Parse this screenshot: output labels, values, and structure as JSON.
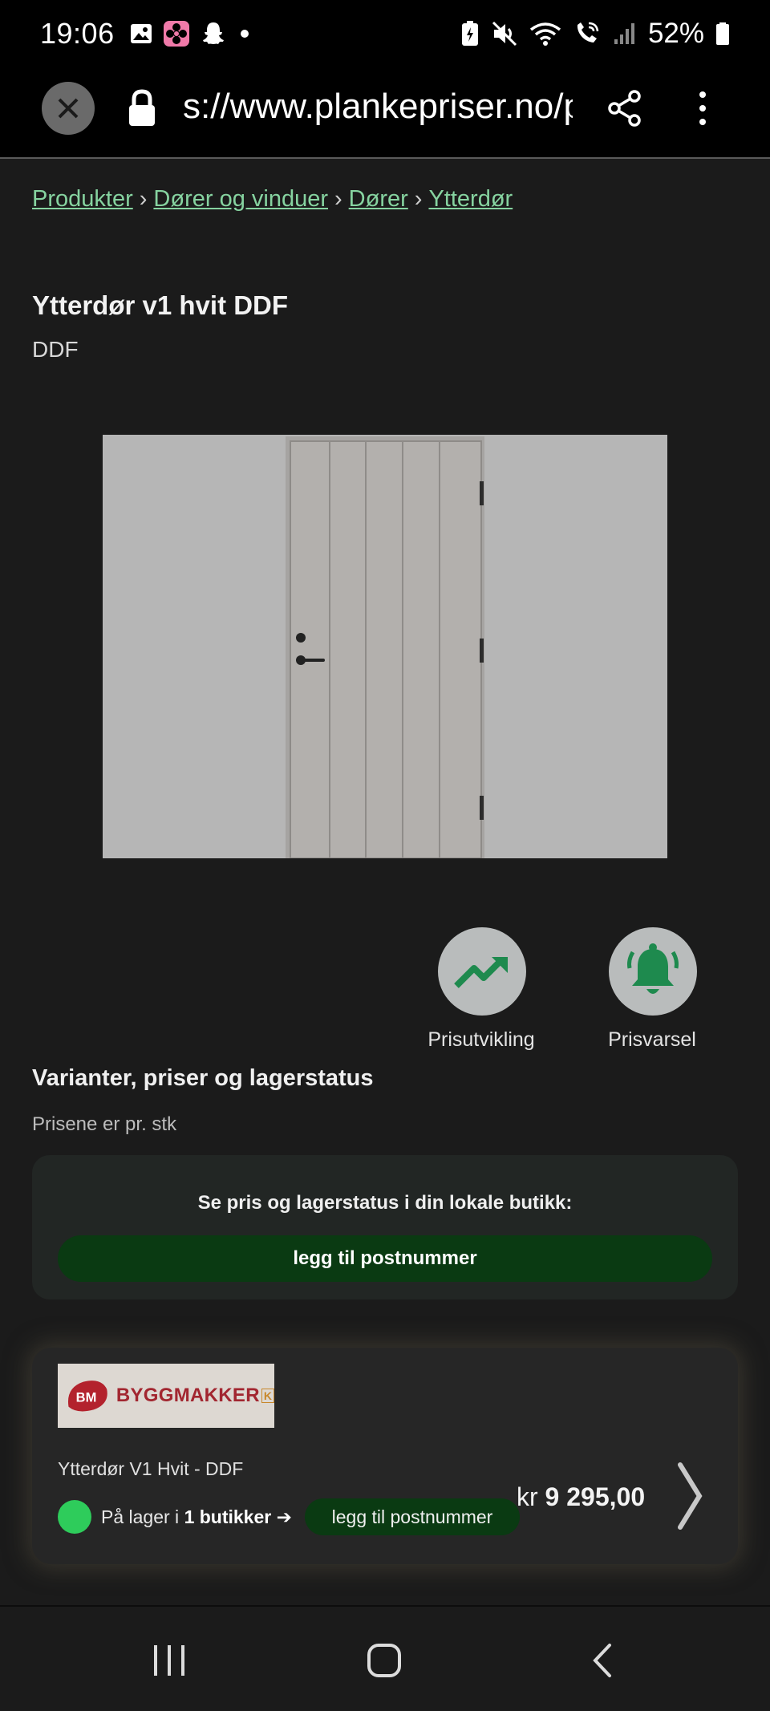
{
  "status_bar": {
    "time": "19:06",
    "battery_percent": "52%",
    "icons_left": [
      "gallery-icon",
      "flower-app-icon",
      "snapchat-icon",
      "dot-icon"
    ],
    "icons_right": [
      "battery-saver-icon",
      "mute-icon",
      "wifi-icon",
      "wifi-calling-icon",
      "signal-icon",
      "battery-icon"
    ]
  },
  "browser": {
    "url": "s://www.plankepriser.no/p"
  },
  "breadcrumb": {
    "items": [
      "Produkter",
      "Dører og vinduer",
      "Dører",
      "Ytterdør"
    ],
    "separator": "›"
  },
  "product": {
    "title": "Ytterdør v1 hvit DDF",
    "brand": "DDF"
  },
  "actions": {
    "price_history_label": "Prisutvikling",
    "price_alert_label": "Prisvarsel"
  },
  "variants": {
    "title": "Varianter, priser og lagerstatus",
    "note": "Prisene er pr. stk"
  },
  "local_store": {
    "prompt": "Se pris og lagerstatus i din lokale butikk:",
    "button_label": "legg til postnummer"
  },
  "offer": {
    "store_logo_text": "BYGGMAKKER",
    "store_logo_badge": "BM",
    "store_logo_mark": "K",
    "product_name": "Ytterdør V1 Hvit - DDF",
    "stock_prefix": "På lager i ",
    "stock_count": "1 butikker",
    "stock_arrow": "➔",
    "pill_label": "legg til postnummer",
    "currency": "kr",
    "price": "9 295,00",
    "stock_color": "#2ecc5b"
  },
  "colors": {
    "link": "#86d3a0",
    "button_green": "#0a3a12",
    "icon_green": "#1e8a4e"
  }
}
